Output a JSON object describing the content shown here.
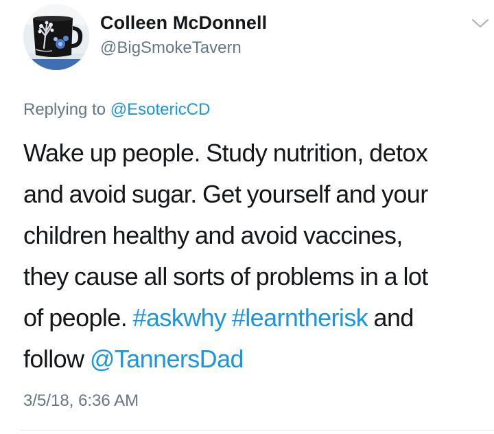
{
  "user": {
    "display_name": "Colleen McDonnell",
    "handle": "@BigSmokeTavern"
  },
  "icons": {
    "more": "chevron-down-icon",
    "avatar": "profile-photo-mug"
  },
  "reply": {
    "prefix": "Replying to",
    "mention": "@EsotericCD"
  },
  "tweet": {
    "line1": "Wake up people. Study nutrition, detox",
    "line2": "and avoid sugar. Get yourself and your",
    "line3": "children healthy and avoid vaccines,",
    "line4": "they cause all sorts of problems in a lot",
    "line5_text": "of people.",
    "hashtag1": "#askwhy",
    "hashtag2": "#learntherisk",
    "line5_tail": "and",
    "line6_text": "follow",
    "mention": "@TannersDad"
  },
  "timestamp": "3/5/18, 6:36 AM",
  "colors": {
    "link": "#1b95e0",
    "secondary_text": "#657786",
    "primary_text": "#14171a"
  }
}
